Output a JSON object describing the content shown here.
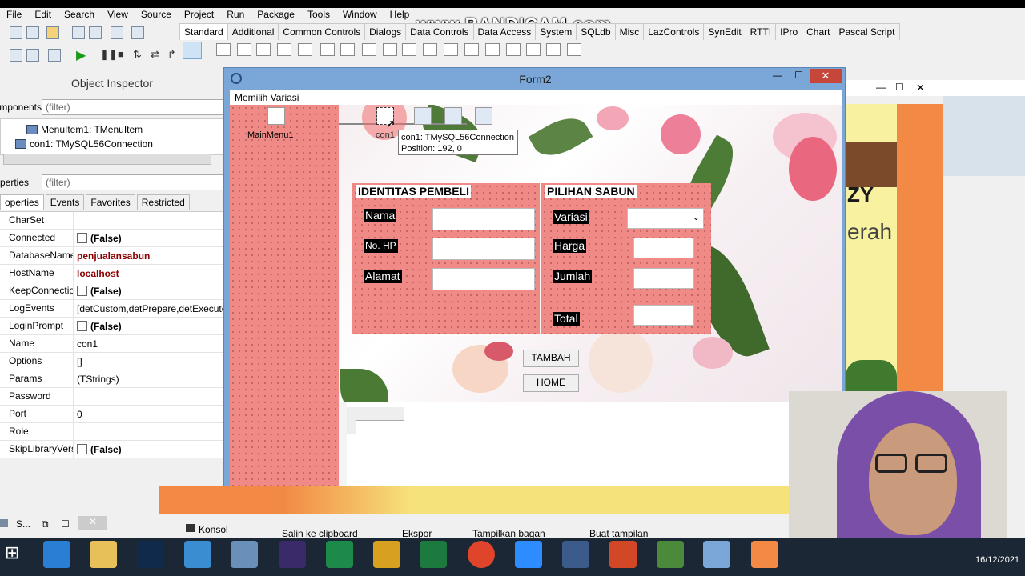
{
  "watermark": "www.BANDICAM.com",
  "menubar": [
    "File",
    "Edit",
    "Search",
    "View",
    "Source",
    "Project",
    "Run",
    "Package",
    "Tools",
    "Window",
    "Help"
  ],
  "palette_tabs": [
    "Standard",
    "Additional",
    "Common Controls",
    "Dialogs",
    "Data Controls",
    "Data Access",
    "System",
    "SQLdb",
    "Misc",
    "LazControls",
    "SynEdit",
    "RTTI",
    "IPro",
    "Chart",
    "Pascal Script"
  ],
  "object_inspector": {
    "title": "Object Inspector",
    "components_label": "mponents",
    "components_filter": "(filter)",
    "tree": [
      "MenuItem1: TMenuItem",
      "con1: TMySQL56Connection"
    ],
    "properties_label": "perties",
    "properties_filter": "(filter)",
    "tabs": [
      "operties",
      "Events",
      "Favorites",
      "Restricted"
    ],
    "props": [
      {
        "name": "CharSet",
        "value": ""
      },
      {
        "name": "Connected",
        "value": "(False)"
      },
      {
        "name": "DatabaseName",
        "value": "penjualansabun"
      },
      {
        "name": "HostName",
        "value": "localhost"
      },
      {
        "name": "KeepConnection",
        "value": "(False)"
      },
      {
        "name": "LogEvents",
        "value": "[detCustom,detPrepare,detExecute,d"
      },
      {
        "name": "LoginPrompt",
        "value": "(False)"
      },
      {
        "name": "Name",
        "value": "con1"
      },
      {
        "name": "Options",
        "value": "[]"
      },
      {
        "name": "Params",
        "value": "(TStrings)"
      },
      {
        "name": "Password",
        "value": ""
      },
      {
        "name": "Port",
        "value": "0"
      },
      {
        "name": "Role",
        "value": ""
      },
      {
        "name": "SkipLibraryVersi",
        "value": "(False)"
      }
    ]
  },
  "form2": {
    "title": "Form2",
    "menu_item": "Memilih Variasi",
    "mainmenu_label": "MainMenu1",
    "con_label": "con1",
    "hint_line1": "con1: TMySQL56Connection",
    "hint_line2": "Position: 192, 0",
    "identitas": {
      "title": "IDENTITAS PEMBELI",
      "fields": [
        "Nama",
        "No. HP",
        "Alamat"
      ]
    },
    "pilihan": {
      "title": "PILIHAN SABUN",
      "fields": [
        "Variasi",
        "Harga",
        "Jumlah",
        "Total"
      ]
    },
    "buttons": {
      "tambah": "TAMBAH",
      "home": "HOME"
    }
  },
  "bg_window": {
    "text1": "ZY",
    "text2": "erah"
  },
  "bottom_bar": {
    "left": "S...",
    "konsol": "Konsol",
    "items": [
      "Salin ke clipboard",
      "Ekspor",
      "Tampilkan bagan",
      "Buat tampilan"
    ]
  },
  "taskbar": {
    "date": "16/12/2021"
  }
}
